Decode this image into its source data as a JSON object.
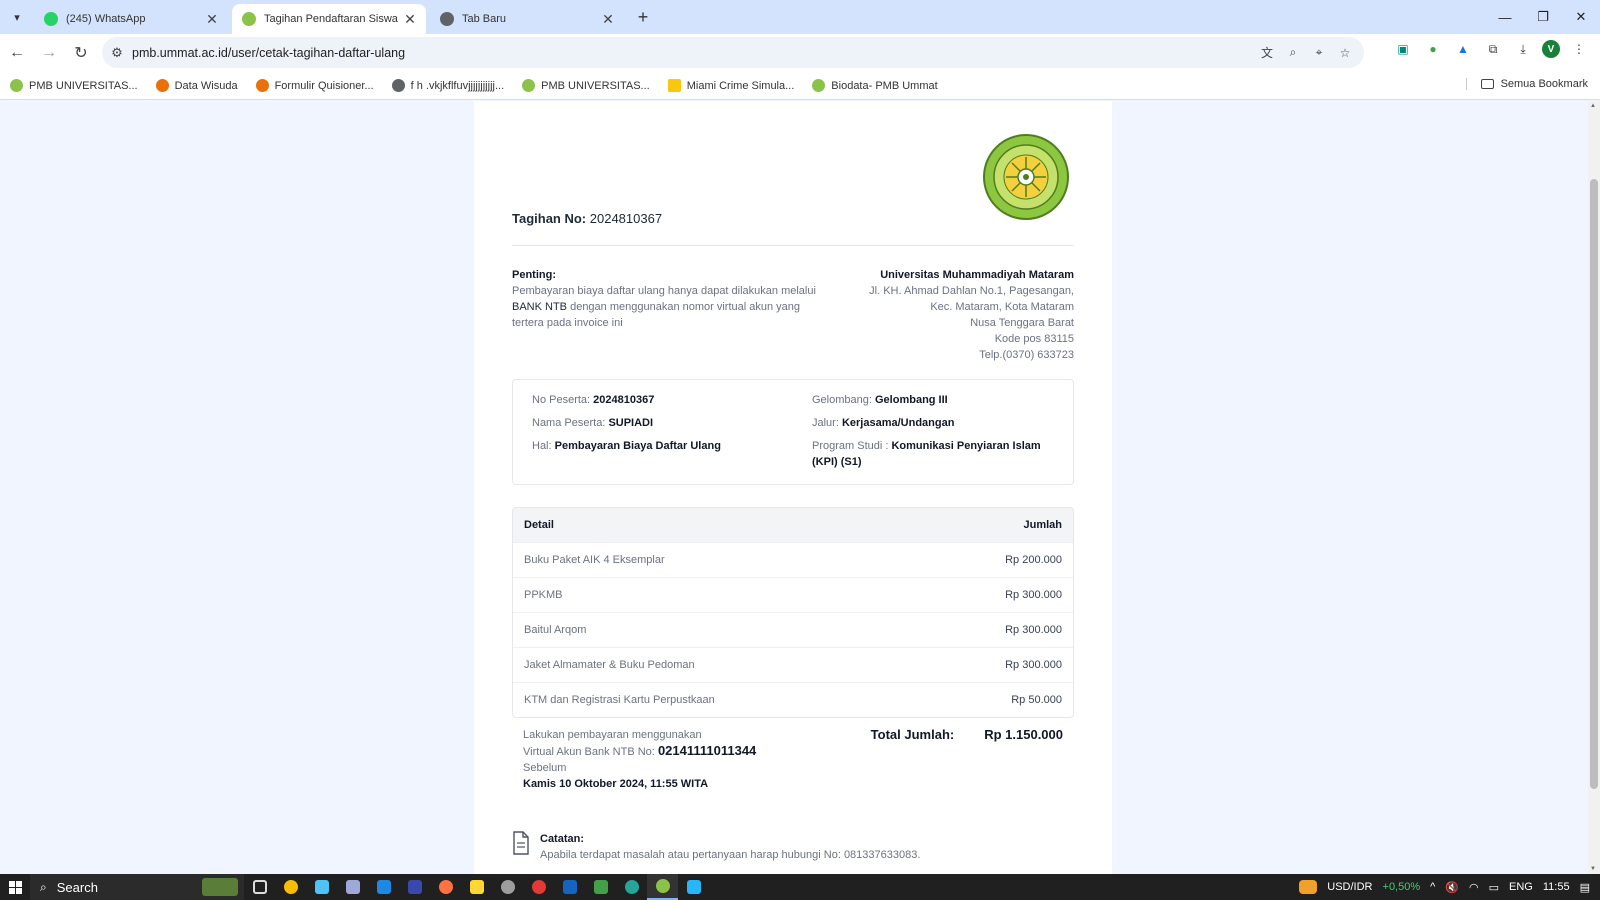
{
  "browser": {
    "tabs": [
      {
        "title": "(245) WhatsApp",
        "active": false,
        "favicon_color": "#25D366"
      },
      {
        "title": "Tagihan Pendaftaran Siswa",
        "active": true,
        "favicon_color": "#8bc34a"
      },
      {
        "title": "Tab Baru",
        "active": false,
        "favicon_color": "#5f6368"
      }
    ],
    "url": "pmb.ummat.ac.id/user/cetak-tagihan-daftar-ulang",
    "bookmarks": [
      {
        "label": "PMB UNIVERSITAS...",
        "color": "#8bc34a"
      },
      {
        "label": "Data Wisuda",
        "color": "#e8710a"
      },
      {
        "label": "Formulir Quisioner...",
        "color": "#e8710a"
      },
      {
        "label": "f h .vkjkflfuvjjjjjjjjjjj...",
        "color": "#5f6368"
      },
      {
        "label": "PMB UNIVERSITAS...",
        "color": "#8bc34a"
      },
      {
        "label": "Miami Crime Simula...",
        "color": "#f9c80e"
      },
      {
        "label": "Biodata- PMB Ummat",
        "color": "#8bc34a"
      }
    ],
    "all_bookmarks": "Semua Bookmark",
    "profile_initial": "V"
  },
  "invoice": {
    "number_label": "Tagihan No:",
    "number": "2024810367",
    "important_label": "Penting:",
    "important_text_1": "Pembayaran biaya daftar ulang hanya dapat dilakukan melalui",
    "important_bank": "BANK NTB",
    "important_text_2": "dengan menggunakan nomor virtual akun yang tertera pada invoice ini",
    "university": {
      "name": "Universitas Muhammadiyah Mataram",
      "address_1": "Jl. KH. Ahmad Dahlan No.1, Pagesangan,",
      "address_2": "Kec. Mataram, Kota Mataram",
      "address_3": "Nusa Tenggara Barat",
      "postal": "Kode pos 83115",
      "phone": "Telp.(0370) 633723"
    },
    "participant": {
      "no_label": "No Peserta:",
      "no": "2024810367",
      "name_label": "Nama Peserta:",
      "name": "SUPIADI",
      "hal_label": "Hal:",
      "hal": "Pembayaran Biaya Daftar Ulang",
      "wave_label": "Gelombang:",
      "wave": "Gelombang III",
      "route_label": "Jalur:",
      "route": "Kerjasama/Undangan",
      "program_label": "Program Studi :",
      "program": "Komunikasi Penyiaran Islam (KPI) (S1)"
    },
    "detail_header": {
      "detail": "Detail",
      "amount": "Jumlah"
    },
    "items": [
      {
        "name": "Buku Paket AIK 4 Eksemplar",
        "amount": "Rp 200.000"
      },
      {
        "name": "PPKMB",
        "amount": "Rp 300.000"
      },
      {
        "name": "Baitul Arqom",
        "amount": "Rp 300.000"
      },
      {
        "name": "Jaket Almamater & Buku Pedoman",
        "amount": "Rp 300.000"
      },
      {
        "name": "KTM dan Registrasi Kartu Perpustkaan",
        "amount": "Rp 50.000"
      }
    ],
    "payment": {
      "line_1": "Lakukan pembayaran menggunakan",
      "va_label": "Virtual Akun Bank NTB No:",
      "va_number": "02141111011344",
      "before": "Sebelum",
      "deadline": "Kamis 10 Oktober 2024, 11:55 WITA"
    },
    "total_label": "Total Jumlah:",
    "total": "Rp 1.150.000",
    "note_label": "Catatan:",
    "note_text": "Apabila terdapat masalah atau pertanyaan harap hubungi No: 081337633083."
  },
  "taskbar": {
    "search": "Search",
    "ticker": "USD/IDR",
    "ticker_change": "+0,50%",
    "lang": "ENG",
    "time": "11:55"
  }
}
